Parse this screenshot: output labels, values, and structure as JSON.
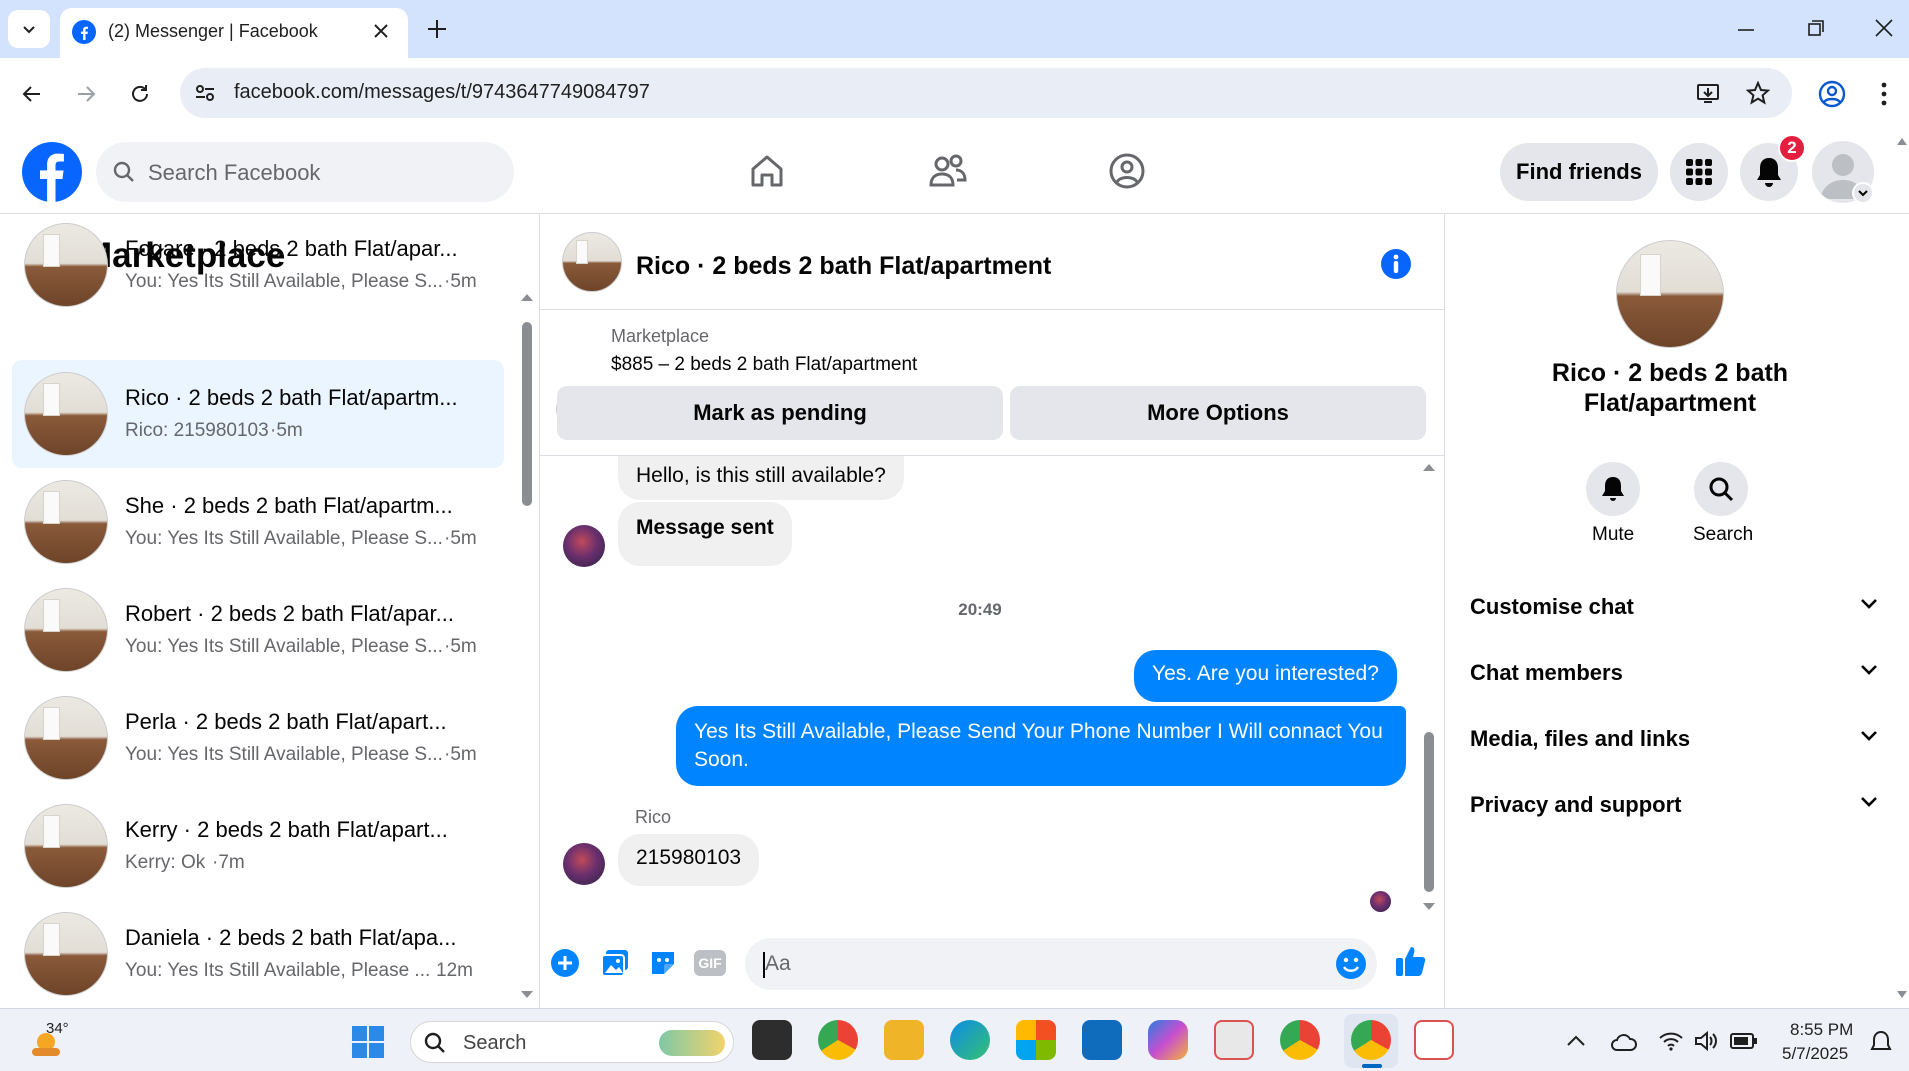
{
  "browser": {
    "tab_title": "(2) Messenger | Facebook",
    "url": "facebook.com/messages/t/9743647749084797"
  },
  "fb": {
    "search_placeholder": "Search Facebook",
    "find_friends": "Find friends",
    "notification_count": "2"
  },
  "left": {
    "title": "Marketplace",
    "conversations": [
      {
        "name": "Fogare · 2 beds 2 bath Flat/apar...",
        "snippet": "You: Yes Its Still Available, Please S...",
        "time": "·5m"
      },
      {
        "name": "Rico · 2 beds 2 bath Flat/apartm...",
        "snippet": "Rico: 215980103",
        "time": "·5m"
      },
      {
        "name": "She · 2 beds 2 bath Flat/apartm...",
        "snippet": "You: Yes Its Still Available, Please S...",
        "time": "·5m"
      },
      {
        "name": "Robert · 2 beds 2 bath Flat/apar...",
        "snippet": "You: Yes Its Still Available, Please S...",
        "time": "·5m"
      },
      {
        "name": "Perla · 2 beds 2 bath Flat/apart...",
        "snippet": "You: Yes Its Still Available, Please S...",
        "time": "·5m"
      },
      {
        "name": "Kerry · 2 beds 2 bath Flat/apart...",
        "snippet": "Kerry: Ok",
        "time": "·7m"
      },
      {
        "name": "Daniela · 2 beds 2 bath Flat/apa...",
        "snippet": "You: Yes Its Still Available, Please ...",
        "time": "12m"
      }
    ]
  },
  "chat": {
    "title": "Rico · 2 beds 2 bath Flat/apartment",
    "listing_label": "Marketplace",
    "listing_title": "$885 – 2 beds 2 bath Flat/apartment",
    "mark_pending": "Mark as pending",
    "more_options": "More Options",
    "messages": {
      "in1": "Hello, is this still available?",
      "in2": "Message sent",
      "timestamp": "20:49",
      "out1": "Yes. Are you interested?",
      "out2": "Yes Its Still Available, Please Send Your Phone Number I Will connact You Soon.",
      "sender": "Rico",
      "in3": "215980103"
    },
    "composer_placeholder": "Aa",
    "gif": "GIF"
  },
  "right": {
    "name": "Rico · 2 beds 2 bath Flat/apartment",
    "mute": "Mute",
    "search": "Search",
    "sections": [
      "Customise chat",
      "Chat members",
      "Media, files and links",
      "Privacy and support"
    ]
  },
  "taskbar": {
    "temp": "34°",
    "search": "Search",
    "time": "8:55 PM",
    "date": "5/7/2025"
  },
  "colors": {
    "accent": "#0084ff",
    "fb_blue": "#0866ff",
    "badge": "#e41e3f"
  }
}
